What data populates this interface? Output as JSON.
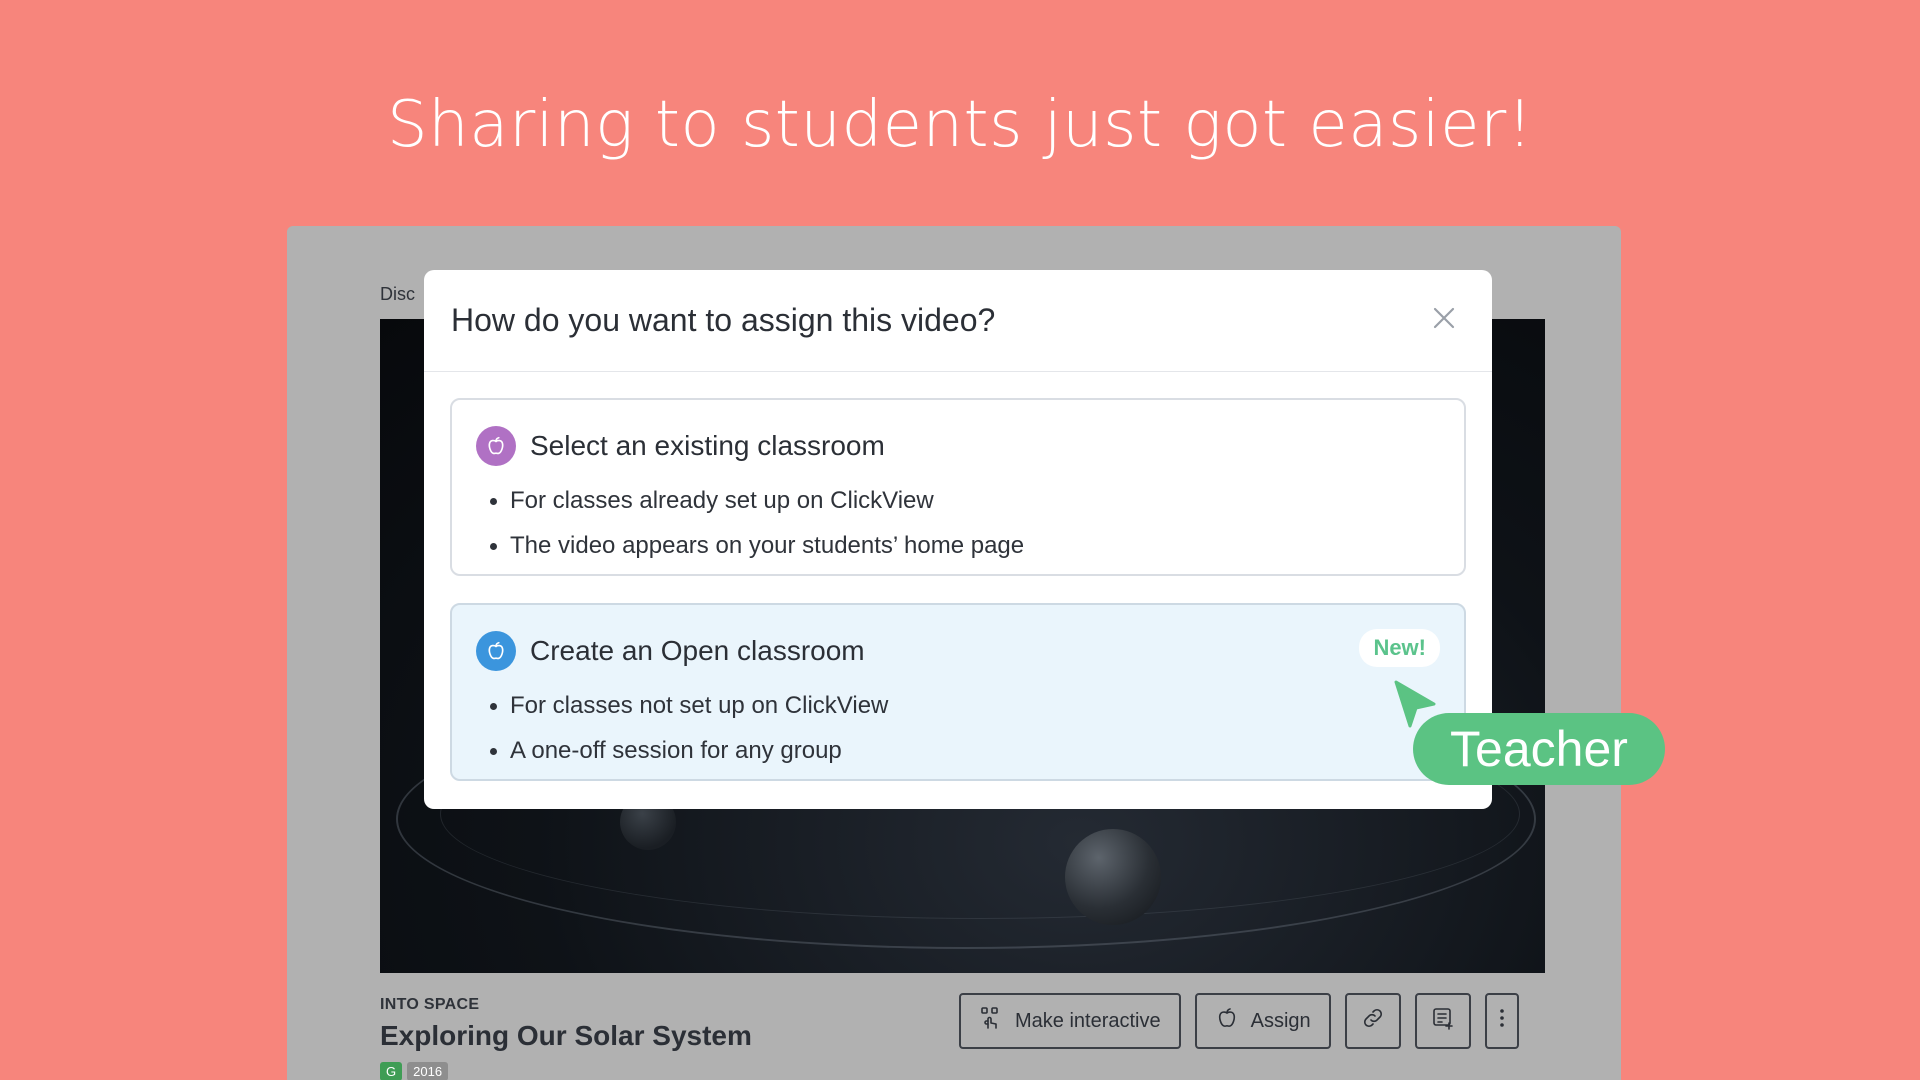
{
  "headline": "Sharing to students just got easier!",
  "app": {
    "breadcrumb": "Disc",
    "video": {
      "series": "INTO SPACE",
      "title": "Exploring Our Solar System",
      "tags": [
        "G",
        "2016"
      ]
    },
    "actions": {
      "make_interactive": "Make interactive",
      "assign": "Assign"
    }
  },
  "modal": {
    "title": "How do you want to assign this video?",
    "options": [
      {
        "title": "Select an existing classroom",
        "icon": "apple-icon",
        "color": "#b071c4",
        "bullets": [
          "For classes already set up on ClickView",
          "The video appears on your students’ home page"
        ]
      },
      {
        "title": "Create an Open classroom",
        "icon": "apple-icon",
        "color": "#3b95dd",
        "badge": "New!",
        "bullets": [
          "For classes not set up on ClickView",
          "A one-off session for any group"
        ]
      }
    ]
  },
  "cursor_label": "Teacher",
  "colors": {
    "background": "#f7857c",
    "accent_green": "#5bc383",
    "open_option_bg": "#eaf5fc"
  }
}
